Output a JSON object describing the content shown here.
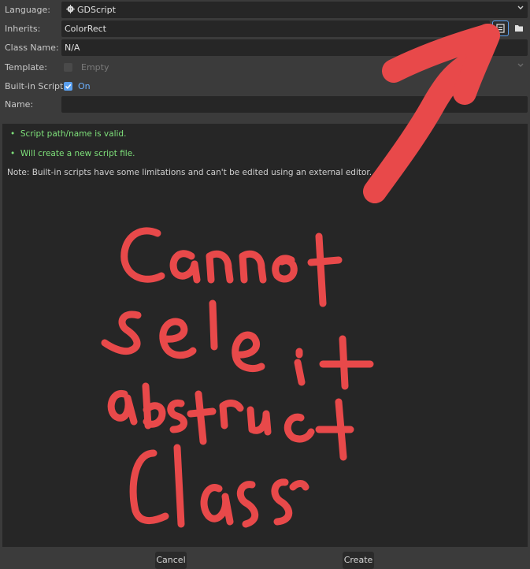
{
  "form": {
    "language": {
      "label": "Language:",
      "value": "GDScript"
    },
    "inherits": {
      "label": "Inherits:",
      "value": "ColorRect"
    },
    "class_name": {
      "label": "Class Name:",
      "value": "N/A"
    },
    "template": {
      "label": "Template:",
      "value": "Empty"
    },
    "builtin": {
      "label": "Built-in Script:",
      "value": "On"
    },
    "name": {
      "label": "Name:",
      "value": ""
    }
  },
  "messages": {
    "path_valid": "Script path/name is valid.",
    "will_create": "Will create a new script file.",
    "note": "Note: Built-in scripts have some limitations and can't be edited using an external editor."
  },
  "buttons": {
    "cancel": "Cancel",
    "create": "Create"
  },
  "annotation_colors": {
    "ink": "#e8494a",
    "accent": "#5aa0f0"
  }
}
